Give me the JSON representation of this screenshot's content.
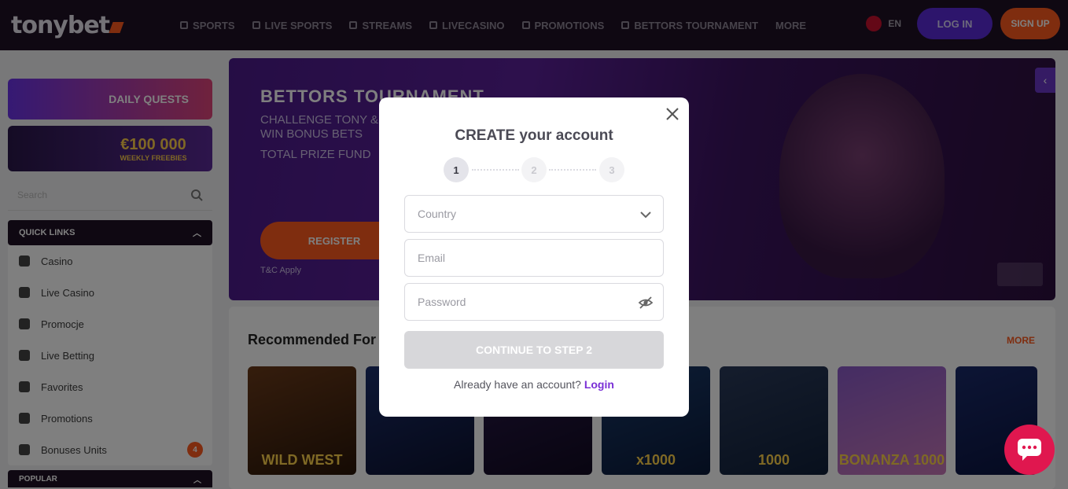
{
  "header": {
    "logo": "tonybet",
    "nav": [
      "SPORTS",
      "LIVE SPORTS",
      "STREAMS",
      "LIVECASINO",
      "PROMOTIONS",
      "BETTORS TOURNAMENT",
      "MORE"
    ],
    "lang": "EN",
    "login_label": "LOG IN",
    "signup_label": "SIGN UP"
  },
  "sidebar": {
    "promo1": "DAILY QUESTS",
    "promo2_big": "€100 000",
    "promo2_small": "WEEKLY FREEBIES",
    "search_placeholder": "Search",
    "section_label": "QUICK LINKS",
    "items": [
      {
        "label": "Casino"
      },
      {
        "label": "Live Casino"
      },
      {
        "label": "Promocje"
      },
      {
        "label": "Live Betting"
      },
      {
        "label": "Favorites"
      },
      {
        "label": "Promotions"
      },
      {
        "label": "Bonuses Units",
        "badge": "4"
      }
    ],
    "section2_label": "POPULAR"
  },
  "hero": {
    "title": "BETTORS TOURNAMENT",
    "subtitle": "CHALLENGE TONY & WIN BONUS BETS",
    "subtitle2": "TOTAL PRIZE FUND",
    "button_label": "REGISTER",
    "tc": "T&C Apply"
  },
  "recommended": {
    "title": "Recommended For You",
    "more": "MORE",
    "games": [
      "WILD WEST",
      "",
      "",
      "x1000",
      "1000",
      "BONANZA 1000",
      ""
    ]
  },
  "modal": {
    "title": "CREATE your account",
    "steps": [
      "1",
      "2",
      "3"
    ],
    "active_step": 1,
    "country_placeholder": "Country",
    "email_placeholder": "Email",
    "password_placeholder": "Password",
    "submit_label": "CONTINUE TO STEP 2",
    "login_prompt": "Already have an account?",
    "login_link": "Login"
  },
  "colors": {
    "accent_purple": "#7a2fd6",
    "accent_orange": "#ff5a1f",
    "disabled_button": "#d7d7da",
    "chat_button": "#e0174f"
  }
}
